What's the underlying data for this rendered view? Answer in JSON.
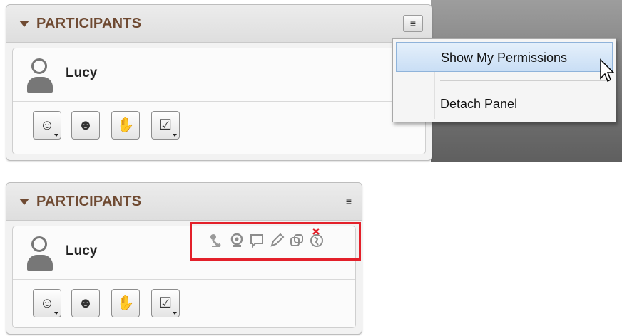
{
  "panel_top": {
    "title": "PARTICIPANTS",
    "user": "Lucy",
    "menu_items": [
      "Show My Permissions",
      "Detach Panel"
    ]
  },
  "panel_bottom": {
    "title": "PARTICIPANTS",
    "user": "Lucy",
    "permission_icons": [
      "microphone-disabled-icon",
      "webcam-icon",
      "chat-bubble-icon",
      "pencil-icon",
      "screen-share-icon",
      "globe-icon"
    ]
  },
  "toolbar_icons": [
    "smiley-status-icon",
    "user-clock-icon",
    "raise-hand-icon",
    "checkbox-icon"
  ],
  "icon_glyphs": {
    "smiley": "☺",
    "user": "☻",
    "hand": "✋",
    "check": "☑",
    "menu": "≡"
  },
  "colors": {
    "title": "#6f4a32",
    "highlight": "#c9def5",
    "permission_box": "#e3202a"
  }
}
